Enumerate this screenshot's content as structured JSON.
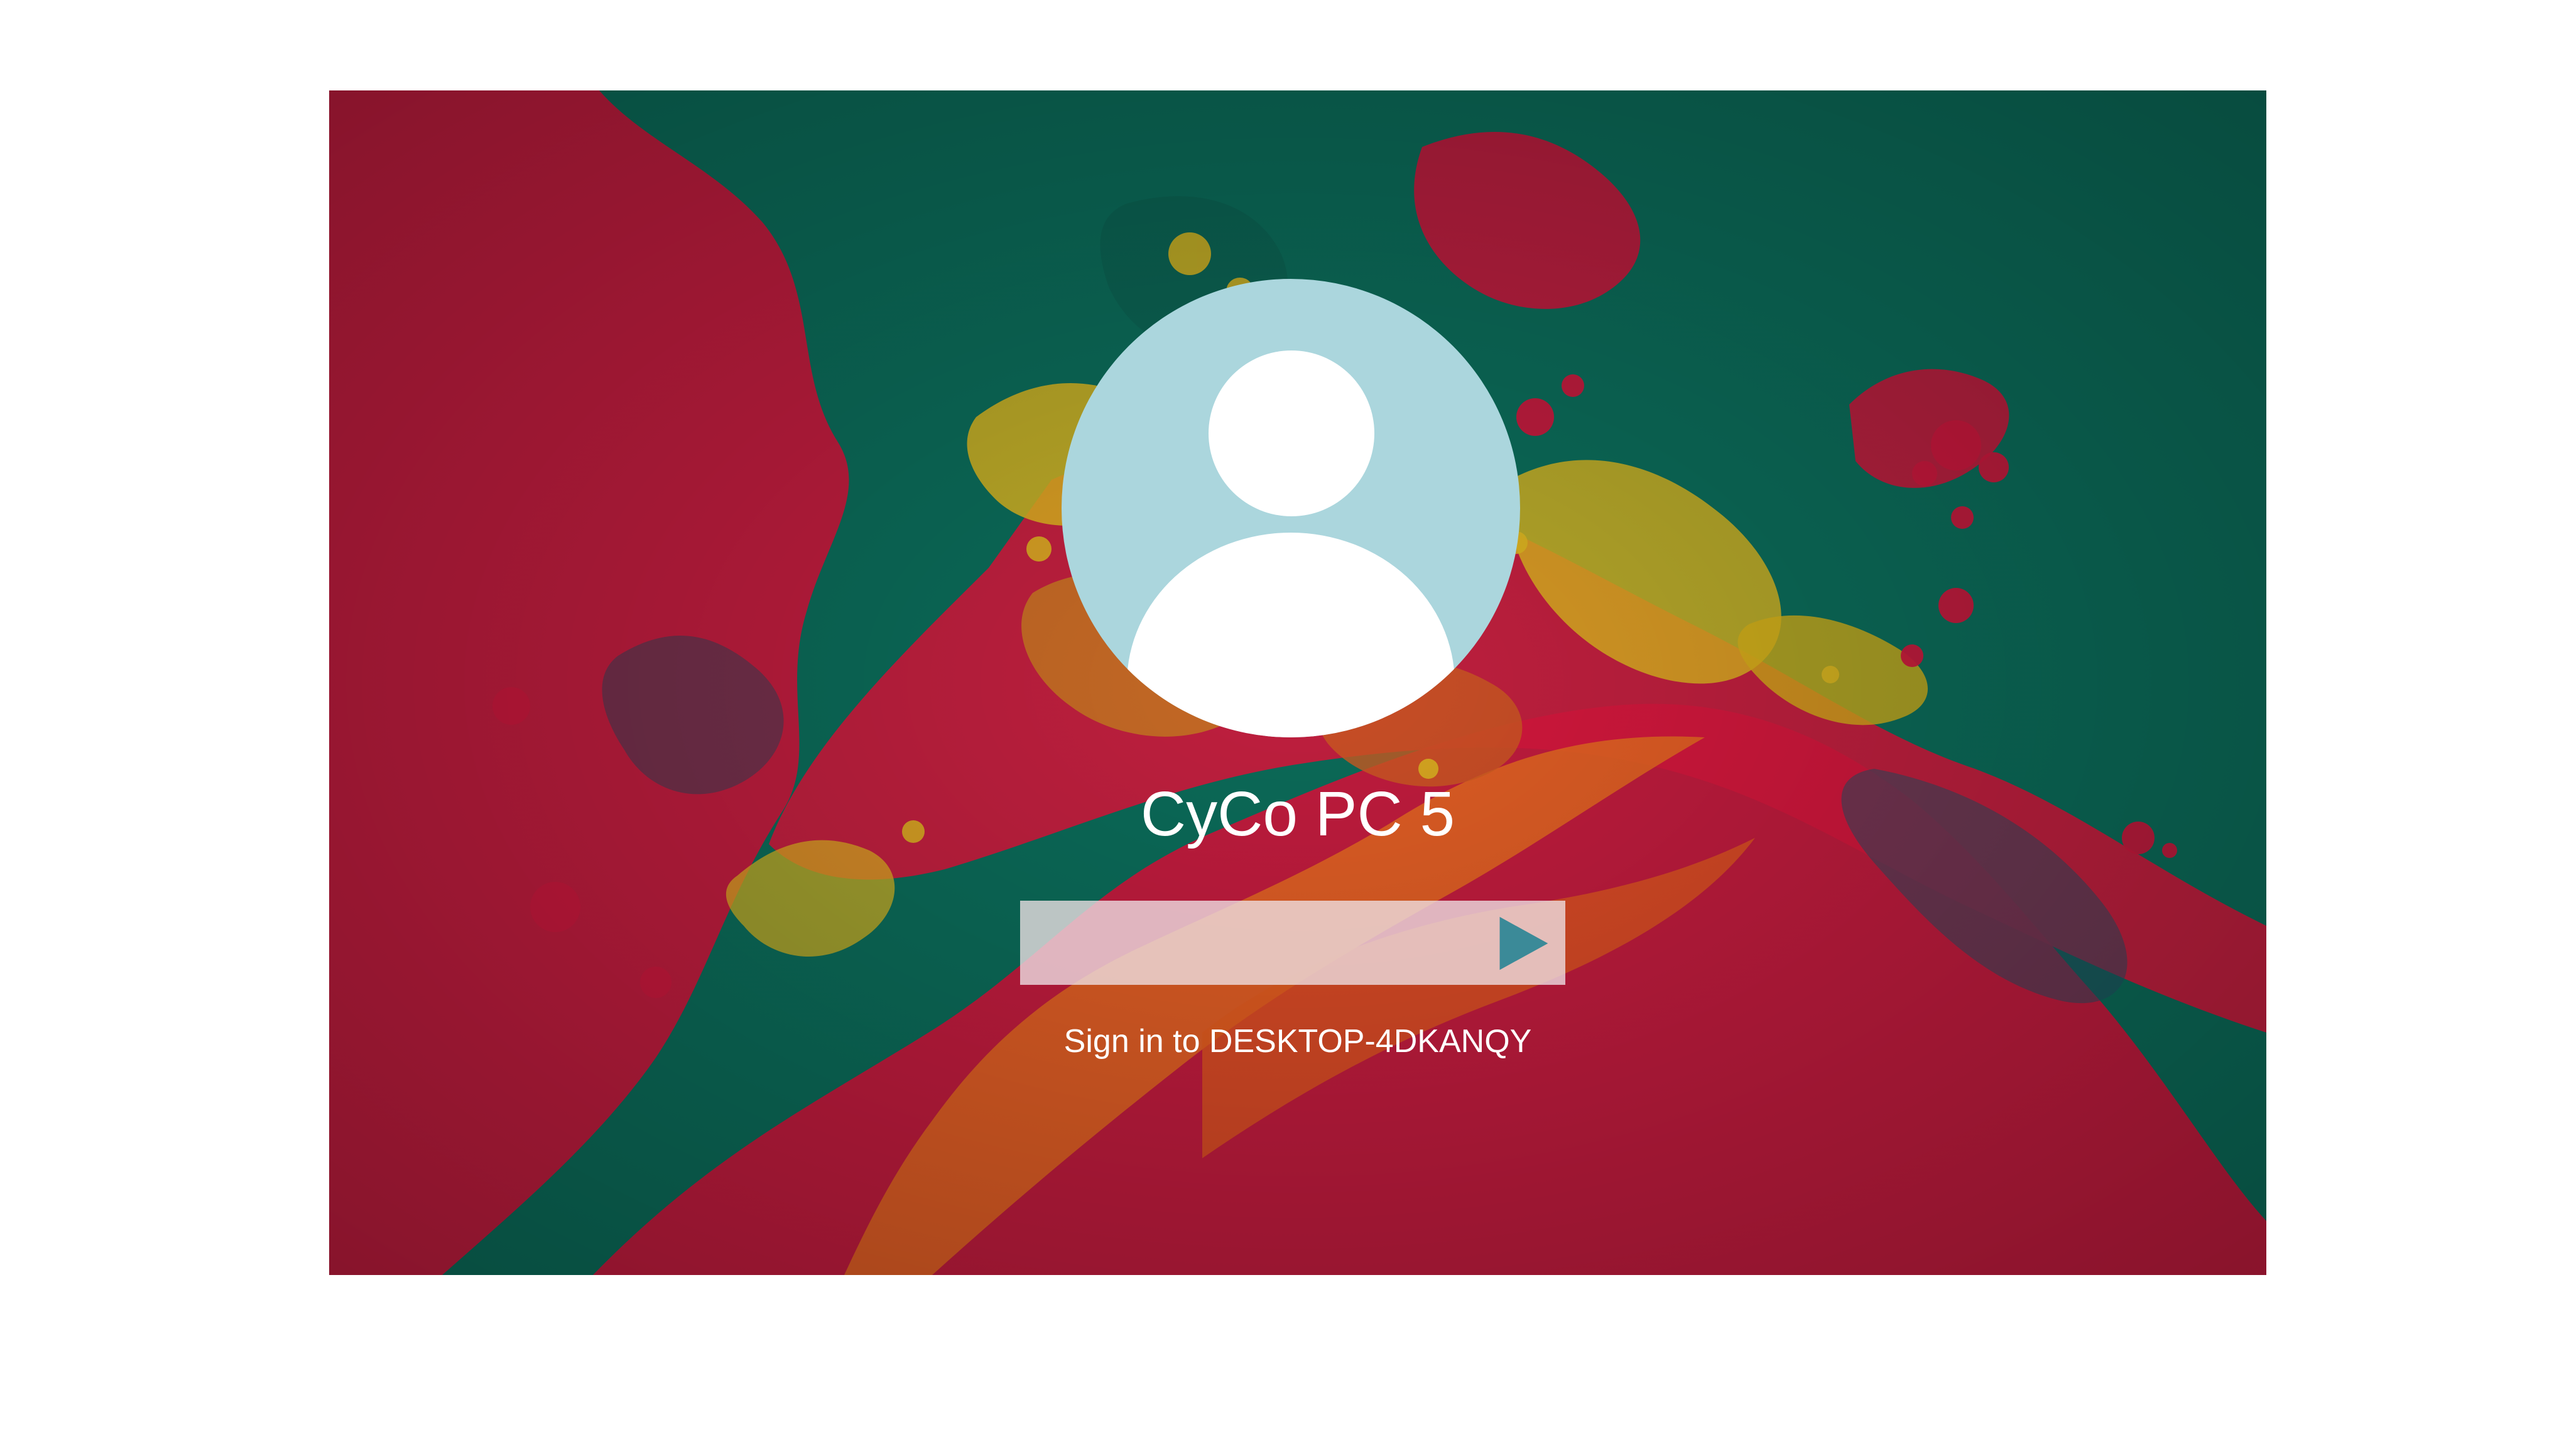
{
  "login": {
    "username": "CyCo PC 5",
    "password": {
      "placeholder": "",
      "value": ""
    },
    "submit_icon": "arrow-right-icon",
    "sign_in_text": "Sign in to DESKTOP-4DKANQY"
  },
  "colors": {
    "wallpaper_primary": "#0b6a58",
    "wallpaper_secondary": "#c7183c",
    "wallpaper_accent": "#d9b31f",
    "avatar_background": "#abd6dd",
    "button_accent": "#3b8a98",
    "input_background": "#eee1e5"
  }
}
